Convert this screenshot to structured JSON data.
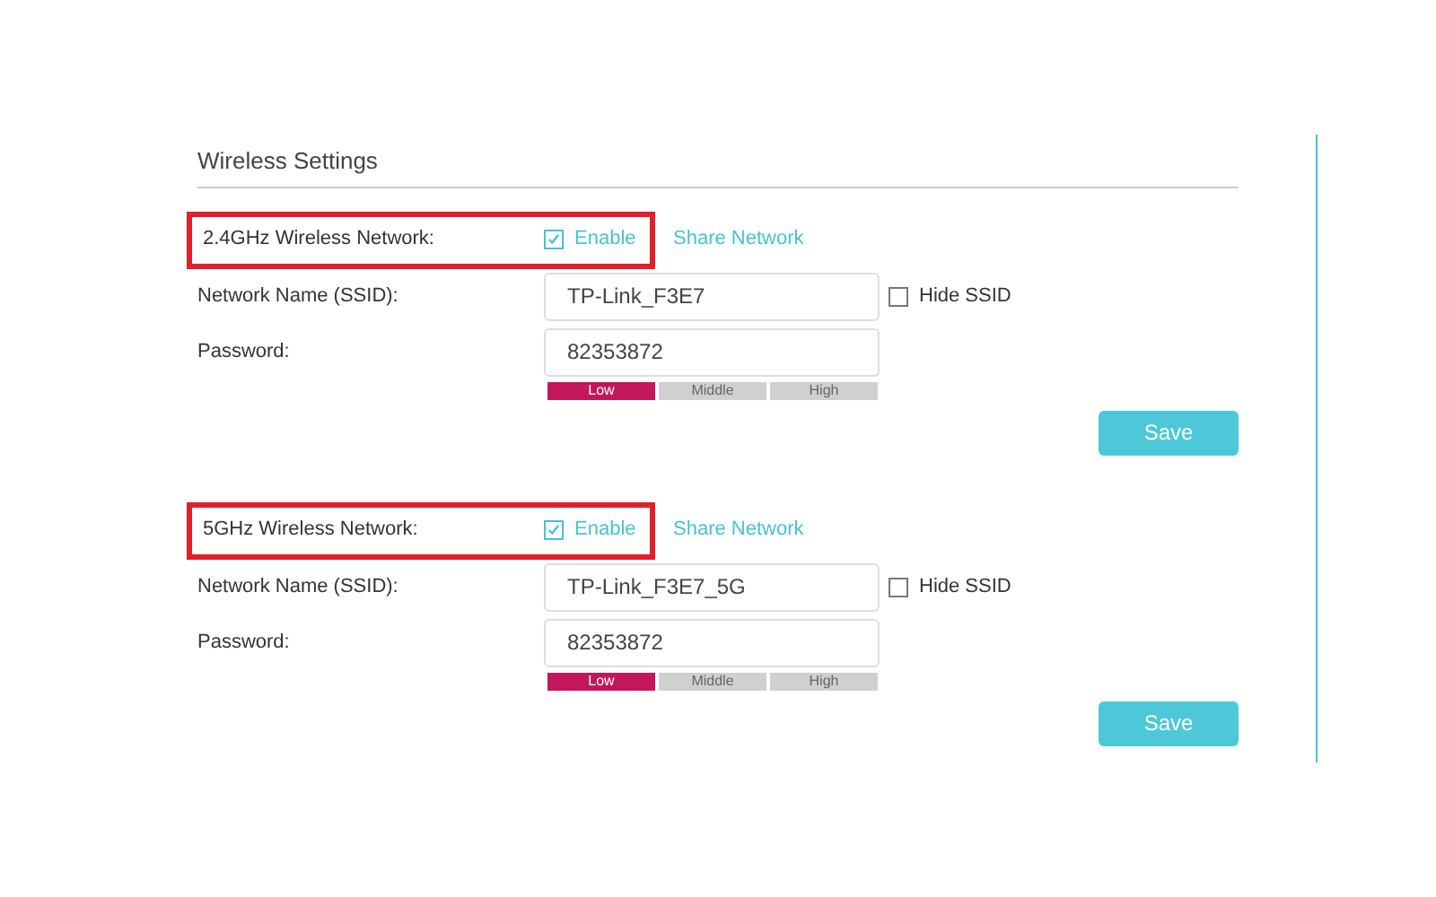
{
  "title": "Wireless Settings",
  "sections": [
    {
      "band_label": "2.4GHz Wireless Network:",
      "highlighted": true,
      "enable": {
        "label": "Enable",
        "checked": true
      },
      "share_link": "Share Network",
      "ssid": {
        "label": "Network Name (SSID):",
        "value": "TP-Link_F3E7",
        "hide": {
          "label": "Hide SSID",
          "checked": false
        }
      },
      "password": {
        "label": "Password:",
        "value": "82353872"
      },
      "strength": [
        {
          "label": "Low",
          "selected": true
        },
        {
          "label": "Middle",
          "selected": false
        },
        {
          "label": "High",
          "selected": false
        }
      ],
      "save": "Save"
    },
    {
      "band_label": "5GHz Wireless Network:",
      "highlighted": true,
      "enable": {
        "label": "Enable",
        "checked": true
      },
      "share_link": "Share Network",
      "ssid": {
        "label": "Network Name (SSID):",
        "value": "TP-Link_F3E7_5G",
        "hide": {
          "label": "Hide SSID",
          "checked": false
        }
      },
      "password": {
        "label": "Password:",
        "value": "82353872"
      },
      "strength": [
        {
          "label": "Low",
          "selected": true
        },
        {
          "label": "Middle",
          "selected": false
        },
        {
          "label": "High",
          "selected": false
        }
      ],
      "save": "Save"
    }
  ]
}
